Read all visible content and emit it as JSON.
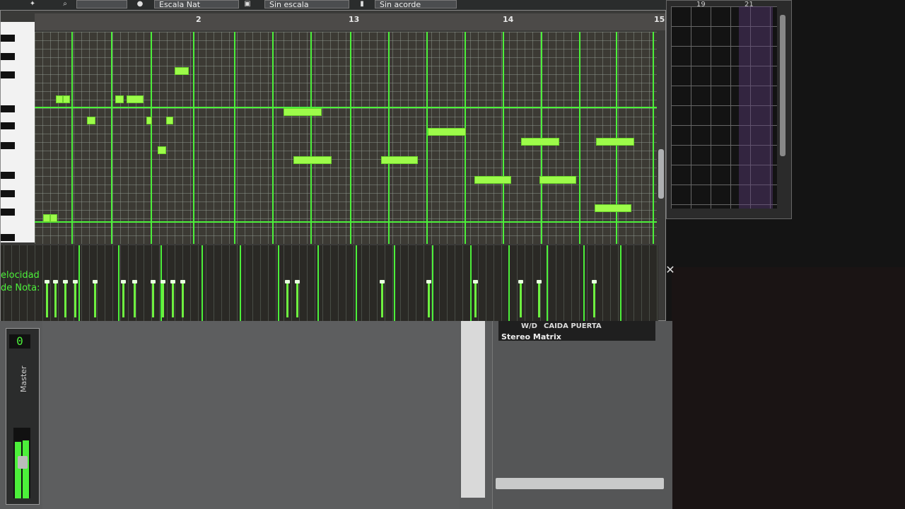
{
  "toolbar": {
    "field1": "",
    "field2": "Escala Nat",
    "field3": "Sin escala",
    "field4": "Sin acorde"
  },
  "piano_roll": {
    "bar_numbers": [
      "2",
      "13",
      "14",
      "15"
    ],
    "velocity_label_line1": "elocidad",
    "velocity_label_line2": "de Nota:"
  },
  "song_editor": {
    "bar_numbers": [
      "19",
      "21"
    ]
  },
  "mixer": {
    "master_value": "0",
    "master_label": "Master",
    "fx_wd": "W/D",
    "fx_effect_name": "CAIDA PUERTA",
    "fx_chain_title": "Stereo Matrix",
    "fx_bottom_label": ""
  },
  "colors": {
    "accent_green": "#4cf03a",
    "note_green": "#9dfb4a",
    "grid_bg": "#3c3a34"
  }
}
